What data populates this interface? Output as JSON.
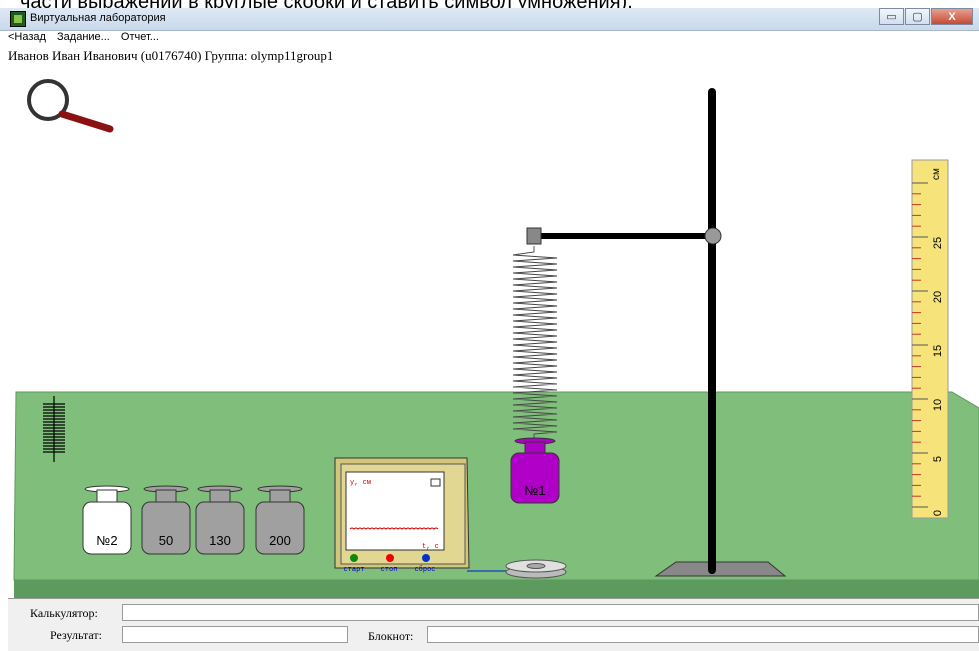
{
  "top_overlay_text": "части выражений в круглые скобки и ставить символ умножения).",
  "window": {
    "title": "Виртуальная лаборатория",
    "buttons": [
      "▭",
      "▢",
      "X"
    ]
  },
  "menu": {
    "back": "<Назад",
    "task": "Задание...",
    "report": "Отчет..."
  },
  "user_line": "Иванов Иван Иванович (u0176740)  Группа: olymp11group1",
  "lab": {
    "weights": [
      "№2",
      "50",
      "130",
      "200"
    ],
    "hanging_weight": "№1",
    "oscilloscope": {
      "axis_y": "y, см",
      "axis_t": "t, c",
      "buttons": [
        "старт",
        "стоп",
        "сброс"
      ]
    },
    "ruler": {
      "unit": "см",
      "ticks": [
        "0",
        "5",
        "10",
        "15",
        "20",
        "25"
      ]
    },
    "colors": {
      "table": "#7fbf7b",
      "table_edge": "#5d9a5d",
      "hanging_weight": "#b000c8",
      "ruler": "#f6e37a"
    }
  },
  "bottom": {
    "calculator_label": "Калькулятор:",
    "result_label": "Результат:",
    "notepad_label": "Блокнот:",
    "calculator_value": "",
    "result_value": "",
    "notepad_value": ""
  }
}
